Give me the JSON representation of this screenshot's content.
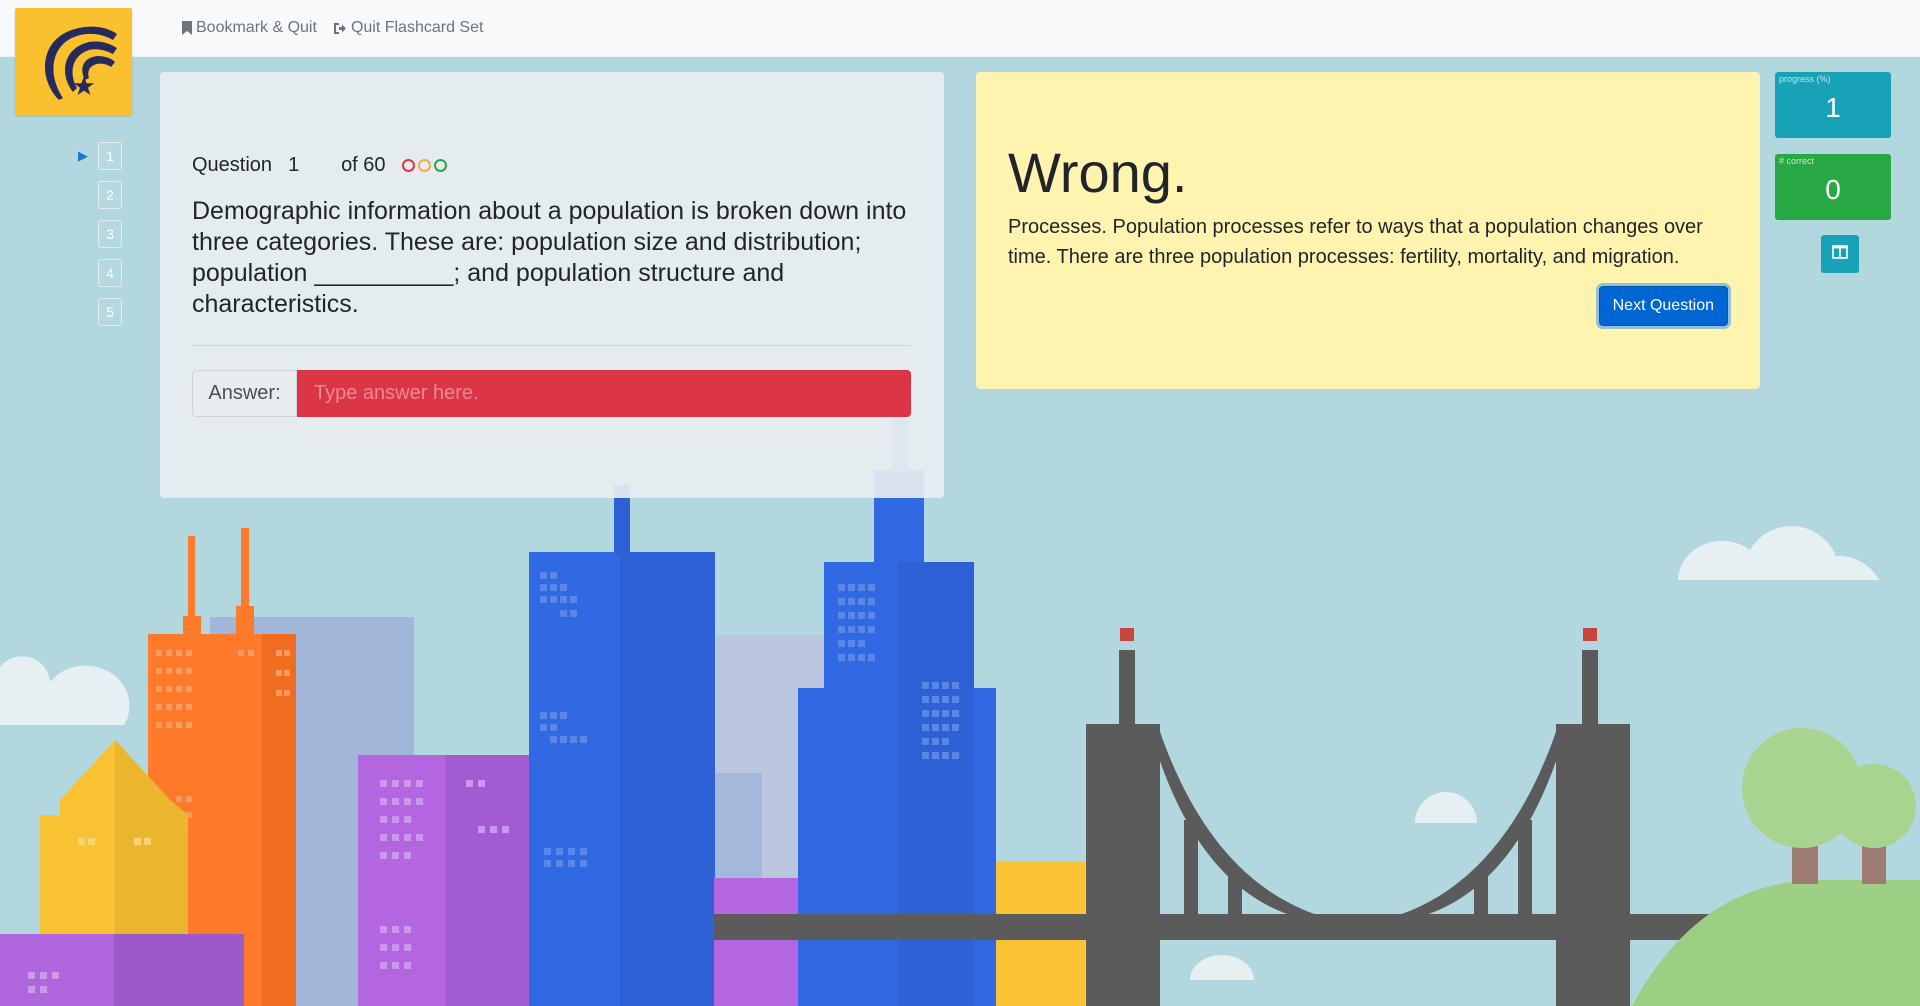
{
  "nav": {
    "bookmark_label": "Bookmark & Quit",
    "quit_label": "Quit Flashcard Set"
  },
  "question_nav": [
    "1",
    "2",
    "3",
    "4",
    "5"
  ],
  "question": {
    "label": "Question",
    "number": "1",
    "of_label": "of 60",
    "status_colors": [
      "#dc3545",
      "#f0ad4e",
      "#28a745"
    ],
    "text": "Demographic information about a population is broken down into three categories. These are: population size and distribution; population __________; and population structure and characteristics.",
    "answer_label": "Answer:",
    "answer_placeholder": "Type answer here.",
    "answer_value": ""
  },
  "feedback": {
    "title": "Wrong.",
    "explanation": "Processes. Population processes refer to ways that a population changes over time. There are three population processes: fertility, mortality, and migration.",
    "next_label": "Next Question"
  },
  "stats": {
    "progress_label": "progress (%)",
    "progress_value": "1",
    "correct_label": "# correct",
    "correct_value": "0"
  },
  "colors": {
    "accent": "#0066d1",
    "logo_bg": "#fbc02d",
    "wrong_input": "#dc3545",
    "feedback_bg": "#fff3b0",
    "progress_tile": "#17a2b8",
    "correct_tile": "#28a745"
  },
  "icons": {
    "bookmark": "bookmark-icon",
    "quit": "sign-out-icon",
    "current_question": "play-arrow-icon",
    "layout": "columns-icon"
  }
}
